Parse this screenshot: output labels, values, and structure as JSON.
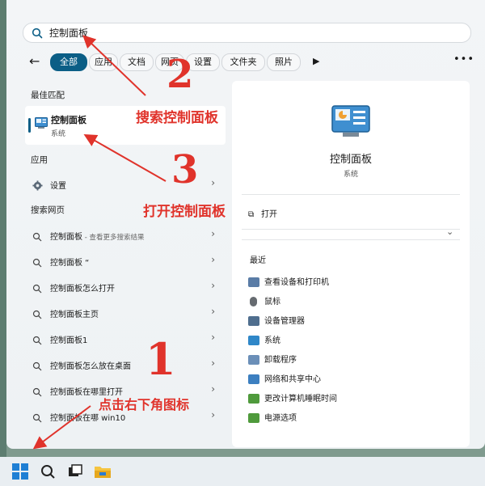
{
  "search": {
    "value": "控制面板"
  },
  "filters": {
    "back": "←",
    "chips": [
      "全部",
      "应用",
      "文档",
      "网页",
      "设置",
      "文件夹",
      "照片"
    ],
    "more": "•••",
    "play": "▶"
  },
  "left": {
    "best_match_heading": "最佳匹配",
    "best_match": {
      "title": "控制面板",
      "subtitle": "系统"
    },
    "apps_heading": "应用",
    "apps": [
      {
        "label": "设置"
      }
    ],
    "web_heading": "搜索网页",
    "web": [
      {
        "label": "控制面板",
        "sub": " - 查看更多搜索结果"
      },
      {
        "label": "控制面板 “",
        "sub": ""
      },
      {
        "label": "控制面板怎么打开",
        "sub": ""
      },
      {
        "label": "控制面板主页",
        "sub": ""
      },
      {
        "label": "控制面板1",
        "sub": ""
      },
      {
        "label": "控制面板怎么放在桌面",
        "sub": ""
      },
      {
        "label": "控制面板在哪里打开",
        "sub": ""
      },
      {
        "label": "控制面板在哪 win10",
        "sub": ""
      }
    ]
  },
  "right": {
    "title": "控制面板",
    "subtitle": "系统",
    "open": "打开",
    "recent_heading": "最近",
    "recent": [
      {
        "label": "查看设备和打印机",
        "color": "#5a7ca6"
      },
      {
        "label": "鼠标",
        "color": "#666b70"
      },
      {
        "label": "设备管理器",
        "color": "#4f6e8e"
      },
      {
        "label": "系统",
        "color": "#2f87c8"
      },
      {
        "label": "卸载程序",
        "color": "#6b8fb8"
      },
      {
        "label": "网络和共享中心",
        "color": "#3c7fc0"
      },
      {
        "label": "更改计算机睡眠时间",
        "color": "#4f9a3c"
      },
      {
        "label": "电源选项",
        "color": "#4f9a3c"
      }
    ]
  },
  "annotations": {
    "n1": "1",
    "t1": "点击右下角图标",
    "n2": "2",
    "t2": "搜索控制面板",
    "n3": "3",
    "t3": "打开控制面板"
  },
  "colors": {
    "accent": "#0b5e86",
    "annotation": "#e0332b"
  }
}
